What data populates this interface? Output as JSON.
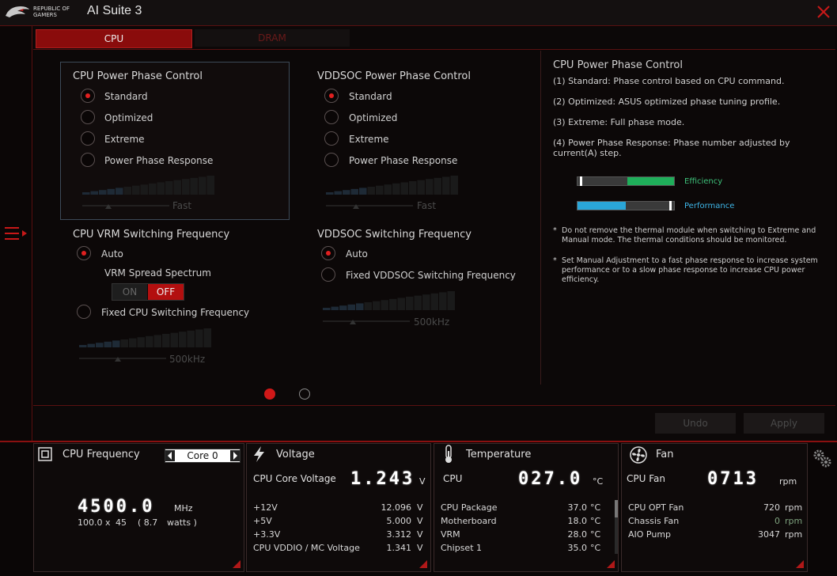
{
  "titlebar": {
    "logo_text": "REPUBLIC OF\nGAMERS",
    "app_title": "AI Suite 3"
  },
  "tabs": [
    {
      "label": "CPU",
      "active": true
    },
    {
      "label": "DRAM",
      "active": false
    }
  ],
  "cpu_phase": {
    "title": "CPU Power Phase Control",
    "options": [
      "Standard",
      "Optimized",
      "Extreme",
      "Power Phase Response"
    ],
    "selected": 0,
    "ramp_label": "Fast"
  },
  "vddsoc_phase": {
    "title": "VDDSOC Power Phase Control",
    "options": [
      "Standard",
      "Optimized",
      "Extreme",
      "Power Phase Response"
    ],
    "selected": 0,
    "ramp_label": "Fast"
  },
  "cpu_vrm": {
    "title": "CPU VRM Switching Frequency",
    "auto_label": "Auto",
    "spread_label": "VRM Spread Spectrum",
    "toggle_on": "ON",
    "toggle_off": "OFF",
    "toggle_state": "OFF",
    "fixed_label": "Fixed CPU Switching Frequency",
    "ramp_label": "500kHz"
  },
  "vddsoc_freq": {
    "title": "VDDSOC Switching Frequency",
    "auto_label": "Auto",
    "fixed_label": "Fixed VDDSOC Switching Frequency",
    "ramp_label": "500kHz"
  },
  "info": {
    "title": "CPU Power Phase Control",
    "lines": [
      "(1) Standard: Phase control based on CPU command.",
      "(2) Optimized: ASUS optimized phase tuning profile.",
      "(3) Extreme: Full phase mode.",
      "(4) Power Phase Response: Phase number adjusted by current(A) step."
    ],
    "efficiency_label": "Efficiency",
    "performance_label": "Performance",
    "efficiency_level": 0.48,
    "performance_level": 0.5,
    "notes": [
      "Do not remove the thermal module when switching to Extreme and Manual mode. The thermal conditions should be monitored.",
      "Set Manual Adjustment to a fast phase response to increase system performance or to a slow phase response to increase CPU power efficiency."
    ],
    "note_star": "*"
  },
  "actions": {
    "undo": "Undo",
    "apply": "Apply"
  },
  "pager": {
    "pages": 2,
    "current": 1
  },
  "dashboard": {
    "cpu_frequency": {
      "title": "CPU Frequency",
      "core": "Core 0",
      "value": "4500.0",
      "unit": "MHz",
      "bclk": "100.0",
      "x": "x",
      "ratio": "45",
      "watts_open": "( 8.7",
      "watts_unit": "watts )"
    },
    "voltage": {
      "title": "Voltage",
      "main_label": "CPU Core Voltage",
      "main_value": "1.243",
      "main_unit": "V",
      "rows": [
        {
          "label": "+12V",
          "value": "12.096",
          "unit": "V"
        },
        {
          "label": "+5V",
          "value": "5.000",
          "unit": "V"
        },
        {
          "label": "+3.3V",
          "value": "3.312",
          "unit": "V"
        },
        {
          "label": "CPU VDDIO / MC Voltage",
          "value": "1.341",
          "unit": "V"
        }
      ]
    },
    "temperature": {
      "title": "Temperature",
      "main_label": "CPU",
      "main_value": "027.0",
      "main_unit": "°C",
      "rows": [
        {
          "label": "CPU Package",
          "value": "37.0",
          "unit": "°C"
        },
        {
          "label": "Motherboard",
          "value": "18.0",
          "unit": "°C"
        },
        {
          "label": "VRM",
          "value": "28.0",
          "unit": "°C"
        },
        {
          "label": "Chipset 1",
          "value": "35.0",
          "unit": "°C"
        }
      ]
    },
    "fan": {
      "title": "Fan",
      "main_label": "CPU Fan",
      "main_value": "0713",
      "main_unit": "rpm",
      "rows": [
        {
          "label": "CPU OPT Fan",
          "value": "720",
          "unit": "rpm"
        },
        {
          "label": "Chassis Fan",
          "value": "0",
          "unit": "rpm"
        },
        {
          "label": "AIO Pump",
          "value": "3047",
          "unit": "rpm"
        }
      ]
    }
  },
  "colors": {
    "accent": "#b30f0f",
    "efficiency": "#1fae5a",
    "performance": "#2aa6d8",
    "panel": "#0c0808"
  }
}
